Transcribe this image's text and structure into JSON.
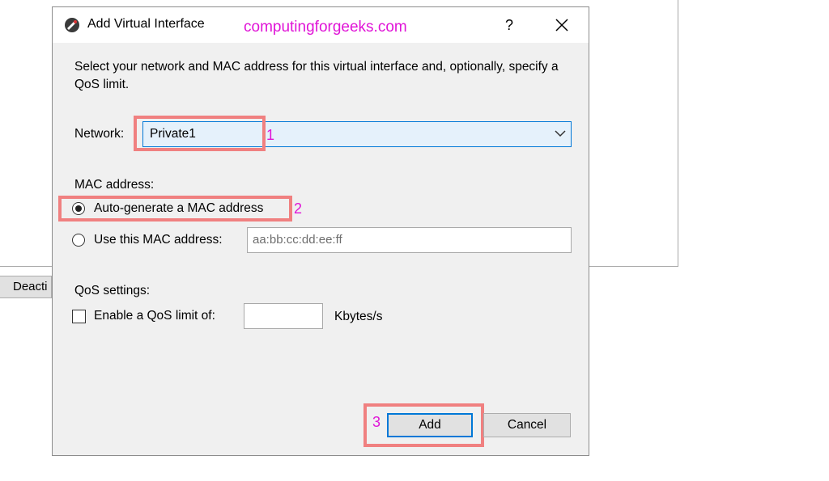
{
  "background": {
    "button_label": "Deacti"
  },
  "dialog": {
    "title": "Add Virtual Interface",
    "watermark": "computingforgeeks.com",
    "help_label": "?",
    "instructions": "Select your network and MAC address for this virtual interface and, optionally, specify a QoS limit.",
    "network": {
      "label": "Network:",
      "value": "Private1"
    },
    "mac": {
      "section_label": "MAC address:",
      "auto_label": "Auto-generate a MAC address",
      "manual_label": "Use this MAC address:",
      "manual_placeholder": "aa:bb:cc:dd:ee:ff",
      "selected": "auto"
    },
    "qos": {
      "section_label": "QoS settings:",
      "enable_label": "Enable a QoS limit of:",
      "value": "",
      "unit": "Kbytes/s",
      "enabled": false
    },
    "buttons": {
      "add": "Add",
      "cancel": "Cancel"
    }
  },
  "annotations": {
    "step1": "1",
    "step2": "2",
    "step3": "3",
    "highlight_color": "#f08080",
    "number_color": "#e014d7"
  },
  "colors": {
    "accent": "#0078d7",
    "dropdown_bg": "#e5f1fb",
    "dialog_bg": "#f0f0f0"
  }
}
